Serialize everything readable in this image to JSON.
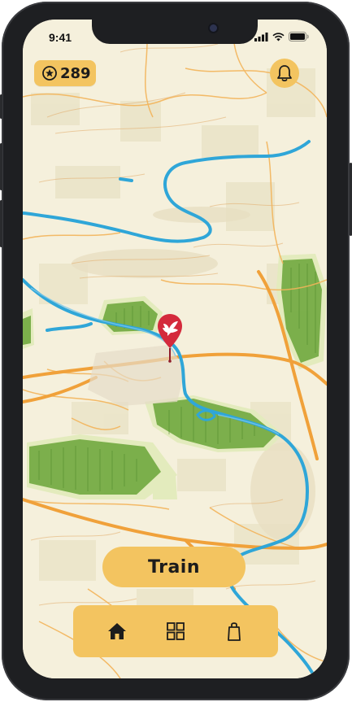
{
  "status_bar": {
    "time": "9:41"
  },
  "header": {
    "score": "289",
    "score_icon": "star-coin-icon",
    "notification_icon": "bell-icon"
  },
  "map": {
    "marker_icon": "dove-icon",
    "marker_color": "#d42a3c",
    "water_color": "#2fa6d8",
    "road_color": "#f0a13a",
    "forest_color": "#6aa538"
  },
  "actions": {
    "train_label": "Train"
  },
  "bottom_nav": [
    {
      "name": "home",
      "icon": "home-icon",
      "active": true
    },
    {
      "name": "grid",
      "icon": "grid-icon",
      "active": false
    },
    {
      "name": "shop",
      "icon": "shopping-bag-icon",
      "active": false
    }
  ],
  "theme": {
    "accent": "#f3c460",
    "background": "#f5f0dc"
  }
}
